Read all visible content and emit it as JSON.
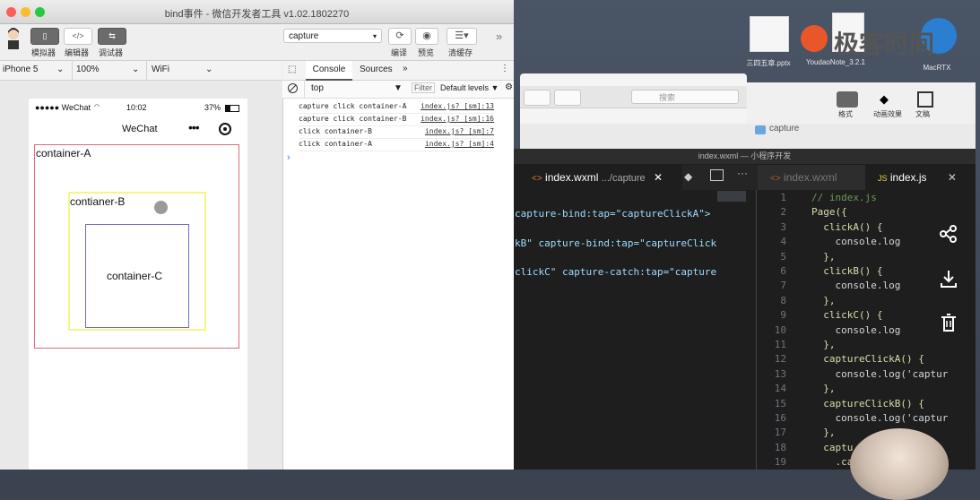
{
  "window": {
    "title": "bind事件 - 微信开发者工具 v1.02.1802270"
  },
  "toolbar": {
    "simulator_label": "模拟器",
    "editor_label": "编辑器",
    "debugger_label": "调试器",
    "debugger_icon_text": "⇆",
    "editor_icon_text": "</>",
    "compile_mode": "capture",
    "compile_label": "编译",
    "preview_label": "预览",
    "clear_cache_label": "清缓存",
    "more": "»"
  },
  "device_bar": {
    "device": "iPhone 5",
    "zoom": "100%",
    "network": "WiFi"
  },
  "phone": {
    "status_carrier": "●●●●● WeChat",
    "status_time": "10:02",
    "status_battery": "37%",
    "nav_title": "WeChat",
    "container_a": "container-A",
    "container_b": "contianer-B",
    "container_c": "container-C"
  },
  "console": {
    "tabs": [
      "Console",
      "Sources"
    ],
    "more": "»",
    "context": "top",
    "filter_label": "Filter",
    "levels_label": "Default levels ▼",
    "prompt": "›",
    "logs": [
      {
        "msg": "capture click container-A",
        "src": "index.js? [sm]:13"
      },
      {
        "msg": "capture click container-B",
        "src": "index.js? [sm]:16"
      },
      {
        "msg": "click container-B",
        "src": "index.js? [sm]:7"
      },
      {
        "msg": "click container-A",
        "src": "index.js? [sm]:4"
      }
    ]
  },
  "desktop": {
    "logo_text": "极客时间",
    "icons": [
      {
        "label": "三四五章.pptx"
      },
      {
        "label": "YoudaoNote_3.2.1"
      },
      {
        "label": "MacRTX"
      }
    ],
    "search_placeholder": "搜索",
    "format_label": "格式",
    "animation_label": "动画效果",
    "doc_label": "文稿",
    "finder_title": "capture"
  },
  "editor": {
    "window_title": "index.wxml — 小程序开发",
    "tab_left": "index.wxml",
    "tab_left_path": ".../capture",
    "tab_right_inactive": "index.wxml",
    "tab_right_active": "index.js",
    "wxml_lines": [
      "capture-bind:tap=\"captureClickA\">",
      "kB\" capture-bind:tap=\"captureClick",
      "clickC\" capture-catch:tap=\"capture"
    ],
    "js_lines": [
      {
        "n": "1",
        "t": "// index.js"
      },
      {
        "n": "2",
        "t": "Page({"
      },
      {
        "n": "3",
        "t": "  clickA() {"
      },
      {
        "n": "4",
        "t": "    console.log"
      },
      {
        "n": "5",
        "t": "  },"
      },
      {
        "n": "6",
        "t": "  clickB() {"
      },
      {
        "n": "7",
        "t": "    console.log"
      },
      {
        "n": "8",
        "t": "  },"
      },
      {
        "n": "9",
        "t": "  clickC() {"
      },
      {
        "n": "10",
        "t": "    console.log"
      },
      {
        "n": "11",
        "t": "  },"
      },
      {
        "n": "12",
        "t": "  captureClickA() {"
      },
      {
        "n": "13",
        "t": "    console.log('captur"
      },
      {
        "n": "14",
        "t": "  },"
      },
      {
        "n": "15",
        "t": "  captureClickB() {"
      },
      {
        "n": "16",
        "t": "    console.log('captur"
      },
      {
        "n": "17",
        "t": "  },"
      },
      {
        "n": "18",
        "t": "  captu"
      },
      {
        "n": "19",
        "t": "    .captur"
      }
    ]
  },
  "overlay_icons": [
    "share-icon",
    "download-icon",
    "trash-icon"
  ]
}
